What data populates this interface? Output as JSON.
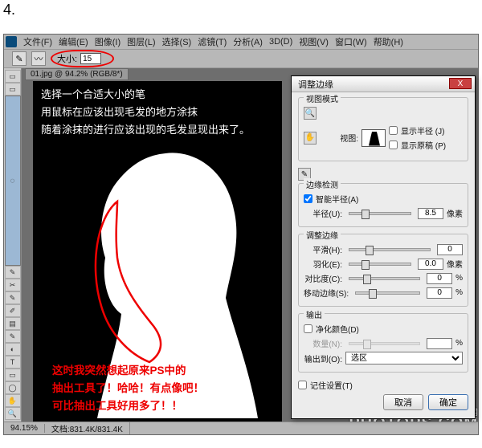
{
  "step_number": "4.",
  "menubar": [
    "文件(F)",
    "编辑(E)",
    "图像(I)",
    "图层(L)",
    "选择(S)",
    "滤镜(T)",
    "分析(A)",
    "3D(D)",
    "视图(V)",
    "窗口(W)",
    "帮助(H)"
  ],
  "options_bar": {
    "size_label": "大小:",
    "size_value": "15"
  },
  "doc_tab": "01.jpg @ 94.2% (RGB/8*)",
  "tips_top": [
    "选择一个合适大小的笔",
    "用鼠标在应该出现毛发的地方涂抹",
    "随着涂抹的进行应该出现的毛发显现出来了。"
  ],
  "tips_bottom": [
    "这时我突然想起原来PS中的",
    "抽出工具了！哈哈！有点像吧！",
    "可比抽出工具好用多了！！"
  ],
  "status": {
    "zoom": "94.15%",
    "doc": "文档:831.4K/831.4K"
  },
  "watermark": {
    "line1": "www.　照片处理网",
    "line2": "PHOTOPS.COM"
  },
  "dialog": {
    "title": "调整边缘",
    "close": "X",
    "view_mode": {
      "label": "视图模式",
      "view": "视图:",
      "show_radius": "显示半径 (J)",
      "show_original": "显示原稿 (P)"
    },
    "edge_detect": {
      "label": "边缘检测",
      "smart": "智能半径(A)",
      "radius": "半径(U):",
      "radius_val": "8.5",
      "unit": "像素"
    },
    "adjust": {
      "label": "调整边缘",
      "smooth": "平滑(H):",
      "smooth_val": "0",
      "feather": "羽化(E):",
      "feather_val": "0.0",
      "feather_unit": "像素",
      "contrast": "对比度(C):",
      "contrast_val": "0",
      "contrast_unit": "%",
      "shift": "移动边缘(S):",
      "shift_val": "0",
      "shift_unit": "%"
    },
    "output": {
      "label": "输出",
      "decon": "净化颜色(D)",
      "amount": "数量(N):",
      "amount_unit": "%",
      "output_to": "输出到(O):",
      "output_sel": "选区"
    },
    "remember": "记住设置(T)",
    "cancel": "取消",
    "ok": "确定"
  },
  "tools": [
    "▭",
    "▭",
    "◌",
    "✎",
    "✂",
    "✎",
    "✐",
    "▤",
    "✎",
    "◐",
    "T",
    "▭",
    "◯",
    "✋",
    "🔍"
  ]
}
